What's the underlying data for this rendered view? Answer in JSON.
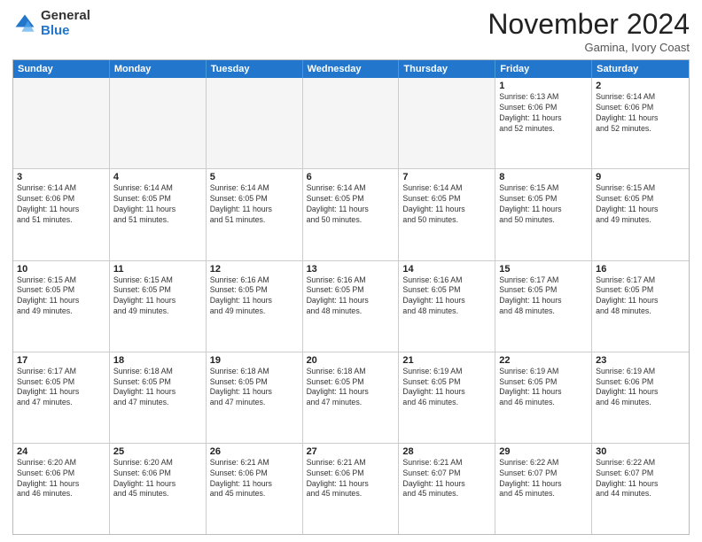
{
  "logo": {
    "general": "General",
    "blue": "Blue"
  },
  "header": {
    "month": "November 2024",
    "location": "Gamina, Ivory Coast"
  },
  "weekdays": [
    "Sunday",
    "Monday",
    "Tuesday",
    "Wednesday",
    "Thursday",
    "Friday",
    "Saturday"
  ],
  "rows": [
    [
      {
        "day": "",
        "info": ""
      },
      {
        "day": "",
        "info": ""
      },
      {
        "day": "",
        "info": ""
      },
      {
        "day": "",
        "info": ""
      },
      {
        "day": "",
        "info": ""
      },
      {
        "day": "1",
        "info": "Sunrise: 6:13 AM\nSunset: 6:06 PM\nDaylight: 11 hours\nand 52 minutes."
      },
      {
        "day": "2",
        "info": "Sunrise: 6:14 AM\nSunset: 6:06 PM\nDaylight: 11 hours\nand 52 minutes."
      }
    ],
    [
      {
        "day": "3",
        "info": "Sunrise: 6:14 AM\nSunset: 6:06 PM\nDaylight: 11 hours\nand 51 minutes."
      },
      {
        "day": "4",
        "info": "Sunrise: 6:14 AM\nSunset: 6:05 PM\nDaylight: 11 hours\nand 51 minutes."
      },
      {
        "day": "5",
        "info": "Sunrise: 6:14 AM\nSunset: 6:05 PM\nDaylight: 11 hours\nand 51 minutes."
      },
      {
        "day": "6",
        "info": "Sunrise: 6:14 AM\nSunset: 6:05 PM\nDaylight: 11 hours\nand 50 minutes."
      },
      {
        "day": "7",
        "info": "Sunrise: 6:14 AM\nSunset: 6:05 PM\nDaylight: 11 hours\nand 50 minutes."
      },
      {
        "day": "8",
        "info": "Sunrise: 6:15 AM\nSunset: 6:05 PM\nDaylight: 11 hours\nand 50 minutes."
      },
      {
        "day": "9",
        "info": "Sunrise: 6:15 AM\nSunset: 6:05 PM\nDaylight: 11 hours\nand 49 minutes."
      }
    ],
    [
      {
        "day": "10",
        "info": "Sunrise: 6:15 AM\nSunset: 6:05 PM\nDaylight: 11 hours\nand 49 minutes."
      },
      {
        "day": "11",
        "info": "Sunrise: 6:15 AM\nSunset: 6:05 PM\nDaylight: 11 hours\nand 49 minutes."
      },
      {
        "day": "12",
        "info": "Sunrise: 6:16 AM\nSunset: 6:05 PM\nDaylight: 11 hours\nand 49 minutes."
      },
      {
        "day": "13",
        "info": "Sunrise: 6:16 AM\nSunset: 6:05 PM\nDaylight: 11 hours\nand 48 minutes."
      },
      {
        "day": "14",
        "info": "Sunrise: 6:16 AM\nSunset: 6:05 PM\nDaylight: 11 hours\nand 48 minutes."
      },
      {
        "day": "15",
        "info": "Sunrise: 6:17 AM\nSunset: 6:05 PM\nDaylight: 11 hours\nand 48 minutes."
      },
      {
        "day": "16",
        "info": "Sunrise: 6:17 AM\nSunset: 6:05 PM\nDaylight: 11 hours\nand 48 minutes."
      }
    ],
    [
      {
        "day": "17",
        "info": "Sunrise: 6:17 AM\nSunset: 6:05 PM\nDaylight: 11 hours\nand 47 minutes."
      },
      {
        "day": "18",
        "info": "Sunrise: 6:18 AM\nSunset: 6:05 PM\nDaylight: 11 hours\nand 47 minutes."
      },
      {
        "day": "19",
        "info": "Sunrise: 6:18 AM\nSunset: 6:05 PM\nDaylight: 11 hours\nand 47 minutes."
      },
      {
        "day": "20",
        "info": "Sunrise: 6:18 AM\nSunset: 6:05 PM\nDaylight: 11 hours\nand 47 minutes."
      },
      {
        "day": "21",
        "info": "Sunrise: 6:19 AM\nSunset: 6:05 PM\nDaylight: 11 hours\nand 46 minutes."
      },
      {
        "day": "22",
        "info": "Sunrise: 6:19 AM\nSunset: 6:05 PM\nDaylight: 11 hours\nand 46 minutes."
      },
      {
        "day": "23",
        "info": "Sunrise: 6:19 AM\nSunset: 6:06 PM\nDaylight: 11 hours\nand 46 minutes."
      }
    ],
    [
      {
        "day": "24",
        "info": "Sunrise: 6:20 AM\nSunset: 6:06 PM\nDaylight: 11 hours\nand 46 minutes."
      },
      {
        "day": "25",
        "info": "Sunrise: 6:20 AM\nSunset: 6:06 PM\nDaylight: 11 hours\nand 45 minutes."
      },
      {
        "day": "26",
        "info": "Sunrise: 6:21 AM\nSunset: 6:06 PM\nDaylight: 11 hours\nand 45 minutes."
      },
      {
        "day": "27",
        "info": "Sunrise: 6:21 AM\nSunset: 6:06 PM\nDaylight: 11 hours\nand 45 minutes."
      },
      {
        "day": "28",
        "info": "Sunrise: 6:21 AM\nSunset: 6:07 PM\nDaylight: 11 hours\nand 45 minutes."
      },
      {
        "day": "29",
        "info": "Sunrise: 6:22 AM\nSunset: 6:07 PM\nDaylight: 11 hours\nand 45 minutes."
      },
      {
        "day": "30",
        "info": "Sunrise: 6:22 AM\nSunset: 6:07 PM\nDaylight: 11 hours\nand 44 minutes."
      }
    ]
  ]
}
